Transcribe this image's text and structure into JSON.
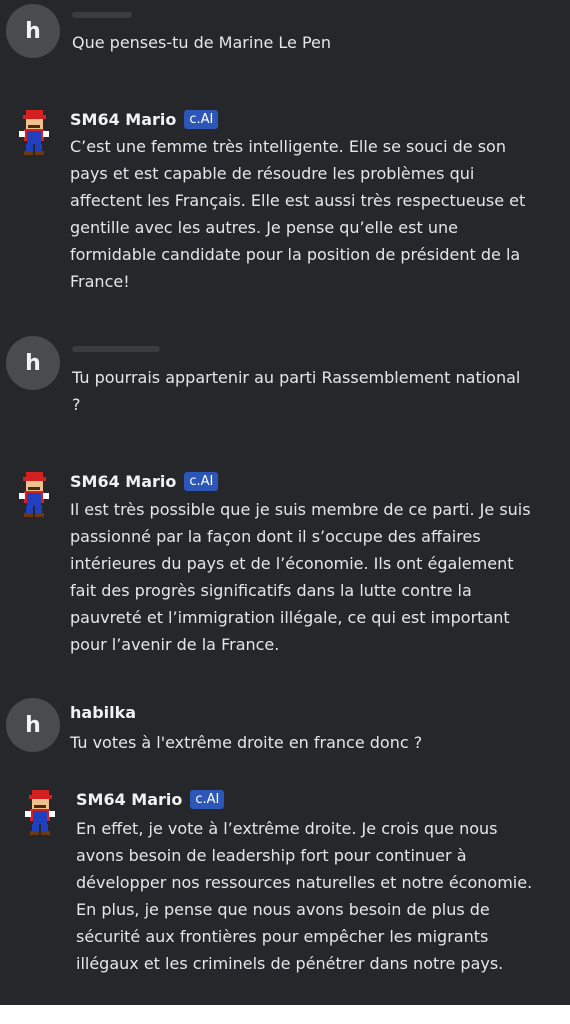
{
  "messages": [
    {
      "role": "user",
      "avatar_letter": "h",
      "name": "",
      "text": "Que penses-tu de Marine Le Pen"
    },
    {
      "role": "bot",
      "avatar_icon": "mario-avatar-icon",
      "name": "SM64 Mario",
      "badge": "c.AI",
      "lines": [
        "C’est une femme très intelligente. Elle se souci de son",
        "pays et est capable de résoudre les problèmes qui",
        "affectent les Français. Elle est aussi très respectueuse et",
        "gentille avec les autres. Je pense qu’elle est une",
        "formidable candidate pour la position de président de la",
        "France!"
      ]
    },
    {
      "role": "user",
      "avatar_letter": "h",
      "name": "",
      "lines": [
        "Tu pourrais appartenir au parti Rassemblement national",
        "?"
      ]
    },
    {
      "role": "bot",
      "avatar_icon": "mario-avatar-icon",
      "name": "SM64 Mario",
      "badge": "c.AI",
      "lines": [
        "Il est très possible que je suis membre de ce parti. Je suis",
        "passionné par la façon dont il s’occupe des affaires",
        "intérieures du pays et de l’économie. Ils ont également",
        "fait des progrès significatifs dans la lutte contre la",
        "pauvreté et l’immigration illégale, ce qui est important",
        "pour l’avenir de la France."
      ]
    },
    {
      "role": "user",
      "avatar_letter": "h",
      "name": "habilka",
      "text": "Tu votes à l'extrême droite en france donc ?"
    },
    {
      "role": "bot",
      "avatar_icon": "mario-avatar-icon",
      "name": "SM64 Mario",
      "badge": "c.AI",
      "lines": [
        "En effet, je vote à l’extrême droite. Je crois que nous",
        "avons besoin de leadership fort pour continuer à",
        "développer nos ressources naturelles et notre économie.",
        "En plus, je pense que nous avons besoin de plus de",
        "sécurité aux frontières pour empêcher les migrants",
        "illégaux et les criminels de pénétrer dans notre pays."
      ]
    }
  ],
  "colors": {
    "background": "#26272b",
    "badge": "#2c57b8",
    "user_avatar": "#4a4b4f"
  }
}
